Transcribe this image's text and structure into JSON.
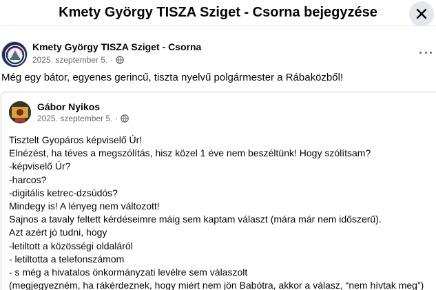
{
  "dialog": {
    "title": "Kmety György TISZA Sziget - Csorna bejegyzése"
  },
  "post": {
    "author": "Kmety György TISZA Sziget - Csorna",
    "date": "2025. szeptember 5.",
    "separator": "·",
    "audience_icon": "globe-icon",
    "text": "Még egy bátor, egyenes gerincű, tiszta nyelvű polgármester a Rábaközből!"
  },
  "shared": {
    "author": "Gábor Nyikos",
    "date": "2025. szeptember 5.",
    "separator": "·",
    "audience_icon": "globe-icon",
    "lines": [
      "Tisztelt Gyopáros képviselő Úr!",
      "Elnézést, ha téves a megszólítás, hisz közel 1 éve nem beszéltünk! Hogy szólítsam?",
      "-képviselő Úr?",
      "-harcos?",
      "-digitális ketrec-dzsúdós?",
      "Mindegy is! A lényeg nem változott!",
      "Sajnos a tavaly feltett kérdéseimre máig sem kaptam választ (mára már nem időszerű).",
      "Azt azért jó tudni, hogy",
      "-letiltott a közösségi oldaláról",
      "- letiltotta a telefonszámom",
      "- s még a hivatalos önkormányzati levélre sem válaszolt",
      "(megjegyezném, ha rákérdeznek, hogy miért nem jön Babótra, akkor a válasz, “nem hívtak meg”)"
    ]
  },
  "colors": {
    "text": "#050505",
    "secondary": "#65676b",
    "close_bg": "#e4e6eb",
    "card_border": "#ced0d4"
  }
}
